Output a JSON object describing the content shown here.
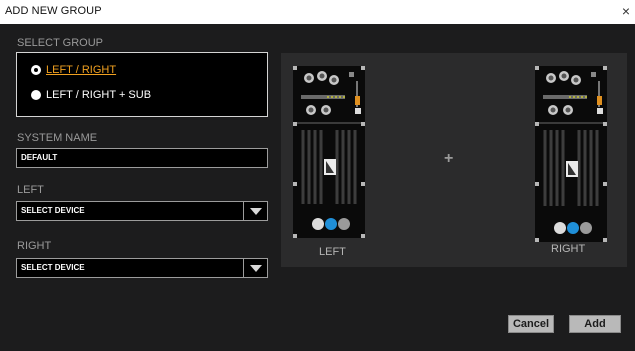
{
  "window": {
    "title": "ADD NEW GROUP",
    "close_glyph": "×"
  },
  "select_group": {
    "label": "SELECT GROUP",
    "options": [
      {
        "label": "LEFT / RIGHT",
        "selected": true
      },
      {
        "label": "LEFT / RIGHT + SUB",
        "selected": false
      }
    ]
  },
  "system_name": {
    "label": "SYSTEM NAME",
    "value": "DEFAULT"
  },
  "left": {
    "label": "LEFT",
    "value": "SELECT DEVICE"
  },
  "right": {
    "label": "RIGHT",
    "value": "SELECT DEVICE"
  },
  "preview": {
    "left_label": "LEFT",
    "right_label": "RIGHT",
    "plus_glyph": "+",
    "knob_colors": [
      "#dcdcdc",
      "#1f8fd8",
      "#9a9a9a"
    ]
  },
  "buttons": {
    "cancel": "Cancel",
    "add": "Add"
  },
  "colors": {
    "accent": "#f0a020",
    "panel": "#1c1c1d",
    "preview_bg": "#2b2b2c"
  }
}
